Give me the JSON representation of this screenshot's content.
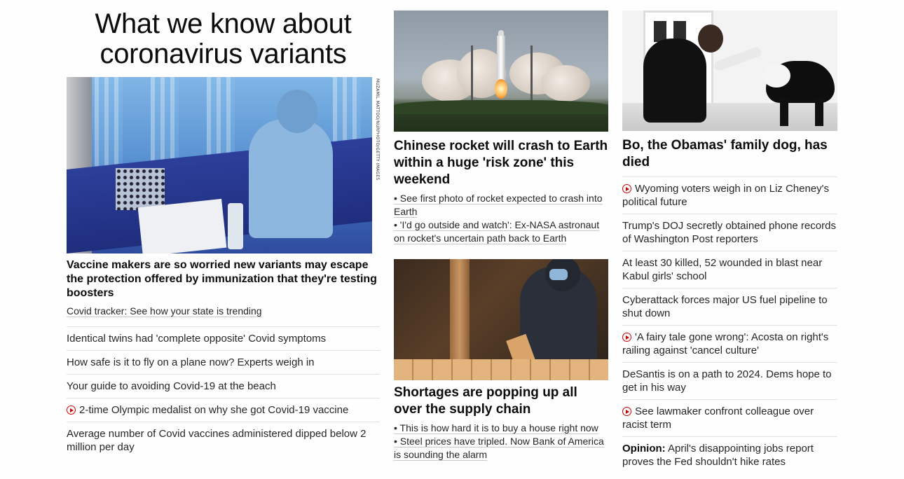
{
  "col1": {
    "title": "What we know about coronavirus variants",
    "photo_credit": "MUZAMIL MATTOO/NURPHOTO/GETTY IMAGES",
    "headline": "Vaccine makers are so worried new variants may escape the protection offered by immunization that they're testing boosters",
    "sub_link": "Covid tracker: See how your state is trending",
    "items": [
      {
        "text": "Identical twins had 'complete opposite' Covid symptoms",
        "video": false
      },
      {
        "text": "How safe is it to fly on a plane now? Experts weigh in",
        "video": false
      },
      {
        "text": "Your guide to avoiding Covid-19 at the beach",
        "video": false
      },
      {
        "text": "2-time Olympic medalist on why she got Covid-19 vaccine",
        "video": true
      },
      {
        "text": "Average number of Covid vaccines administered dipped below 2 million per day",
        "video": false
      }
    ]
  },
  "col2": {
    "rocket": {
      "headline": "Chinese rocket will crash to Earth within a huge 'risk zone' this weekend",
      "bullets": [
        "• See first photo of rocket expected to crash into Earth",
        "• 'I'd go outside and watch': Ex-NASA astronaut on rocket's uncertain path back to Earth"
      ]
    },
    "supply": {
      "headline": "Shortages are popping up all over the supply chain",
      "bullets": [
        "• This is how hard it is to buy a house right now",
        "• Steel prices have tripled. Now Bank of America is sounding the alarm"
      ]
    }
  },
  "col3": {
    "headline": "Bo, the Obamas' family dog, has died",
    "items": [
      {
        "text": "Wyoming voters weigh in on Liz Cheney's political future",
        "video": true
      },
      {
        "text": "Trump's DOJ secretly obtained phone records of Washington Post reporters",
        "video": false
      },
      {
        "text": "At least 30 killed, 52 wounded in blast near Kabul girls' school",
        "video": false
      },
      {
        "text": "Cyberattack forces major US fuel pipeline to shut down",
        "video": false
      },
      {
        "text": "'A fairy tale gone wrong': Acosta on right's railing against 'cancel culture'",
        "video": true
      },
      {
        "text": "DeSantis is on a path to 2024. Dems hope to get in his way",
        "video": false
      },
      {
        "text": "See lawmaker confront colleague over racist term",
        "video": true
      }
    ],
    "opinion_label": "Opinion:",
    "opinion_text": " April's disappointing jobs report proves the Fed shouldn't hike rates"
  },
  "colors": {
    "play_red": "#cc0000",
    "text": "#262626",
    "divider": "#e2e2e2"
  }
}
